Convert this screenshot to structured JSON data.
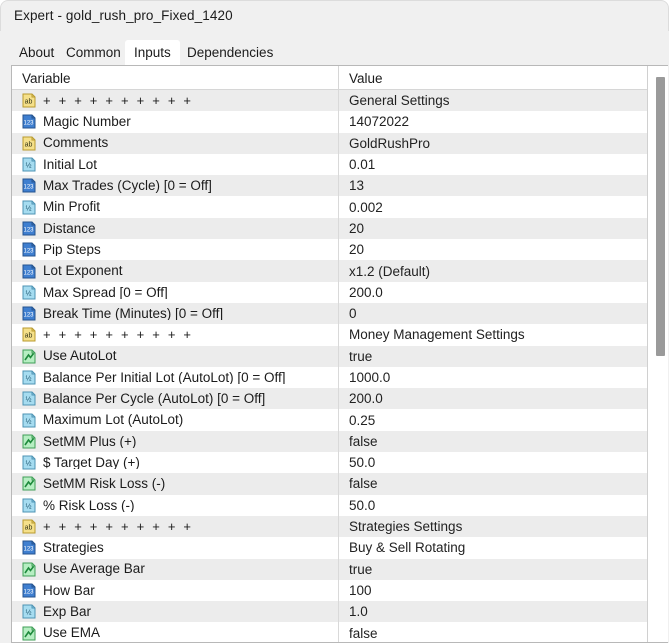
{
  "window": {
    "title": "Expert - gold_rush_pro_Fixed_1420"
  },
  "tabs": [
    {
      "label": "About",
      "active": false
    },
    {
      "label": "Common",
      "active": false
    },
    {
      "label": "Inputs",
      "active": true
    },
    {
      "label": "Dependencies",
      "active": false
    }
  ],
  "table": {
    "columns": {
      "variable": "Variable",
      "value": "Value"
    },
    "rows": [
      {
        "icon": "string-type-icon",
        "variable": "+ + + + + + + + + +",
        "value": "General Settings",
        "separator": true
      },
      {
        "icon": "integer-type-icon",
        "variable": "Magic Number",
        "value": "14072022",
        "separator": false
      },
      {
        "icon": "string-type-icon",
        "variable": "Comments",
        "value": "GoldRushPro",
        "separator": false
      },
      {
        "icon": "double-type-icon",
        "variable": "Initial Lot",
        "value": "0.01",
        "separator": false
      },
      {
        "icon": "integer-type-icon",
        "variable": "Max Trades (Cycle) [0 = Off]",
        "value": "13",
        "separator": false
      },
      {
        "icon": "double-type-icon",
        "variable": "Min Profit",
        "value": "0.002",
        "separator": false
      },
      {
        "icon": "integer-type-icon",
        "variable": "Distance",
        "value": "20",
        "separator": false
      },
      {
        "icon": "integer-type-icon",
        "variable": "Pip Steps",
        "value": "20",
        "separator": false
      },
      {
        "icon": "integer-type-icon",
        "variable": "Lot Exponent",
        "value": "x1.2 (Default)",
        "separator": false
      },
      {
        "icon": "double-type-icon",
        "variable": "Max Spread [0 = Off]",
        "value": "200.0",
        "separator": false
      },
      {
        "icon": "integer-type-icon",
        "variable": "Break Time (Minutes) [0 = Off]",
        "value": "0",
        "separator": false
      },
      {
        "icon": "string-type-icon",
        "variable": "+ + + + + + + + + +",
        "value": "Money Management Settings",
        "separator": true
      },
      {
        "icon": "boolean-type-icon",
        "variable": "Use AutoLot",
        "value": "true",
        "separator": false
      },
      {
        "icon": "double-type-icon",
        "variable": "Balance Per Initial Lot (AutoLot) [0 = Off]",
        "value": "1000.0",
        "separator": false
      },
      {
        "icon": "double-type-icon",
        "variable": "Balance Per Cycle (AutoLot) [0 = Off]",
        "value": "200.0",
        "separator": false
      },
      {
        "icon": "double-type-icon",
        "variable": "Maximum Lot (AutoLot)",
        "value": "0.25",
        "separator": false
      },
      {
        "icon": "boolean-type-icon",
        "variable": "SetMM Plus (+)",
        "value": "false",
        "separator": false
      },
      {
        "icon": "double-type-icon",
        "variable": "$ Target Day (+)",
        "value": "50.0",
        "separator": false
      },
      {
        "icon": "boolean-type-icon",
        "variable": "SetMM Risk Loss (-)",
        "value": "false",
        "separator": false
      },
      {
        "icon": "double-type-icon",
        "variable": "% Risk Loss (-)",
        "value": "50.0",
        "separator": false
      },
      {
        "icon": "string-type-icon",
        "variable": "+ + + + + + + + + +",
        "value": "Strategies Settings",
        "separator": true
      },
      {
        "icon": "integer-type-icon",
        "variable": "Strategies",
        "value": "Buy & Sell Rotating",
        "separator": false
      },
      {
        "icon": "boolean-type-icon",
        "variable": "Use Average Bar",
        "value": "true",
        "separator": false
      },
      {
        "icon": "integer-type-icon",
        "variable": "How Bar",
        "value": "100",
        "separator": false
      },
      {
        "icon": "double-type-icon",
        "variable": "Exp Bar",
        "value": "1.0",
        "separator": false
      },
      {
        "icon": "boolean-type-icon",
        "variable": "Use EMA",
        "value": "false",
        "separator": false
      }
    ]
  },
  "scrollbar": {
    "orientation": "vertical",
    "thumb_position": "top"
  },
  "colors": {
    "row_alt": "#ececec",
    "row_norm": "#ffffff",
    "text": "#1b1b1b",
    "string_icon": "#f2d96b",
    "number_icon": "#3a78c8",
    "double_icon": "#8fd4ec",
    "boolean_icon": "#4ec16a",
    "scrollbar_thumb": "#9a9a9a"
  }
}
